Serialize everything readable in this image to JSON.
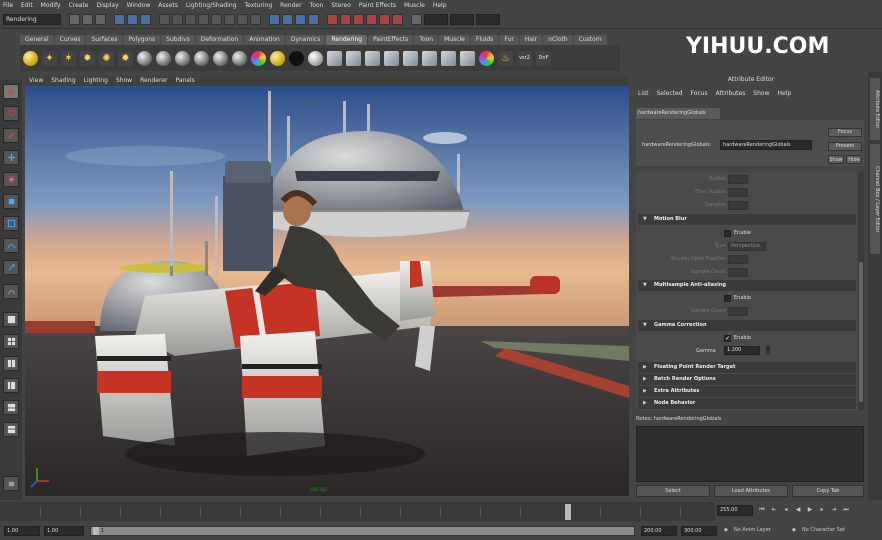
{
  "menu": [
    "File",
    "Edit",
    "Modify",
    "Create",
    "Display",
    "Window",
    "Assets",
    "Lighting/Shading",
    "Texturing",
    "Render",
    "Toon",
    "Stereo",
    "Paint Effects",
    "Muscle",
    "Help"
  ],
  "status": {
    "mode": "Rendering"
  },
  "watermark": {
    "brand": "YIHUU",
    "suffix": ".COM"
  },
  "shelf_tabs": [
    "General",
    "Curves",
    "Surfaces",
    "Polygons",
    "Subdivs",
    "Deformation",
    "Animation",
    "Dynamics",
    "Rendering",
    "PaintEffects",
    "Toon",
    "Muscle",
    "Fluids",
    "Fur",
    "Hair",
    "nCloth",
    "Custom"
  ],
  "shelf_tab_active": "Rendering",
  "shelf_labels": {
    "vsr": "vsr2",
    "dnf": "DnF"
  },
  "viewport": {
    "menu": [
      "View",
      "Shading",
      "Lighting",
      "Show",
      "Renderer",
      "Panels"
    ],
    "label": "persp",
    "camera_label": "persp"
  },
  "attribute_editor": {
    "title": "Attribute Editor",
    "menu": [
      "List",
      "Selected",
      "Focus",
      "Attributes",
      "Show",
      "Help"
    ],
    "node_tab": "hardwareRenderingGlobals",
    "node_label": "hardwareRenderingGlobals:",
    "node_value": "hardwareRenderingGlobals",
    "buttons": {
      "focus": "Focus",
      "presets": "Presets",
      "show": "Show",
      "hide": "Hide"
    },
    "dim_rows": [
      "Radius",
      "Filter Radius",
      "Samples"
    ],
    "sections": {
      "motion_blur": "Motion Blur",
      "msaa": "Multisample Anti-aliasing",
      "gamma": "Gamma Correction",
      "floating": "Floating Point Render Target",
      "batch": "Batch Render Options",
      "extra": "Extra Attributes",
      "node": "Node Behavior"
    },
    "motion_blur_rows": [
      "Type",
      "Shutter Open Fraction",
      "Sample Count"
    ],
    "motion_blur_type": "Perspective",
    "msaa_rows": [
      "Sample Count"
    ],
    "enable_label": "Enable",
    "gamma": {
      "label": "Gamma",
      "value": "1.200"
    },
    "notes_label": "Notes: hardwareRenderingGlobals",
    "bottom_buttons": [
      "Select",
      "Load Attributes",
      "Copy Tab"
    ]
  },
  "right_tabs": [
    "Attribute Editor",
    "Channel Box / Layer Editor"
  ],
  "timeline": {
    "current_frame": "255.00"
  },
  "range": {
    "start": "1.00",
    "anim_start": "1.00",
    "slider_start": "1",
    "anim_end": "200.00",
    "end": "300.00",
    "anim_layer": "No Anim Layer",
    "char_set": "No Character Set"
  }
}
